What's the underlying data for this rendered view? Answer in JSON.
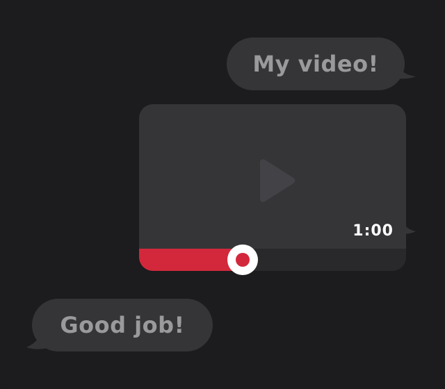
{
  "messages": {
    "outgoing_text": "My video!",
    "incoming_text": "Good job!"
  },
  "video": {
    "duration": "1:00",
    "progress": 0.385,
    "play_icon": "play-icon"
  },
  "colors": {
    "background": "#1c1b1e",
    "bubble": "#353538",
    "bubble_text": "#9a9a9d",
    "accent": "#d3283b",
    "track": "#29282b"
  }
}
